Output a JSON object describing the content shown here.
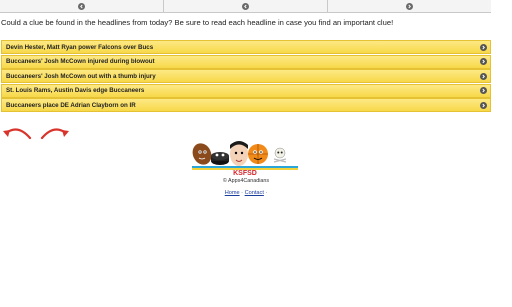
{
  "topbar": {
    "tabs": [
      {
        "icon": "chevron-left-circle-icon"
      },
      {
        "icon": "chevron-left-circle-icon"
      },
      {
        "icon": "chevron-right-circle-icon"
      }
    ]
  },
  "intro_text": "Could a clue be found in the headlines from today? Be sure to read each headline in case you find an important clue!",
  "headlines": [
    "Devin Hester, Matt Ryan power Falcons over Bucs",
    "Buccaneers' Josh McCown injured during blowout",
    "Buccaneers' Josh McCown out with a thumb injury",
    "St. Louis Rams, Austin Davis edge Buccaneers",
    "Buccaneers place DE Adrian Clayborn on IR"
  ],
  "nav_arrows": {
    "back": "curved-left-arrow-icon",
    "forward": "curved-right-arrow-icon"
  },
  "logo": {
    "text": "KSFSD"
  },
  "copyright": "© Apps4Canadians",
  "footer": {
    "home": "Home",
    "separator": " · ",
    "contact": "Contact",
    "trailing": " ·"
  },
  "colors": {
    "accent_yellow": "#f7d84a",
    "arrow_red": "#d9342b",
    "link_blue": "#1a3d9c"
  }
}
